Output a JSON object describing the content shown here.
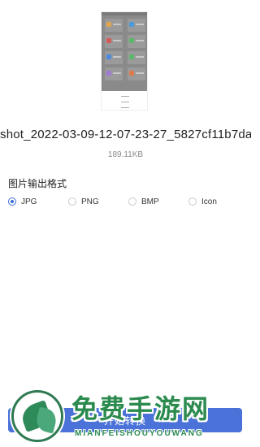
{
  "file": {
    "name": "shot_2022-03-09-12-07-23-27_5827cf11b7da",
    "size": "189.11KB"
  },
  "output_format": {
    "title": "图片输出格式",
    "selected": "JPG",
    "options": [
      "JPG",
      "PNG",
      "BMP",
      "Icon"
    ]
  },
  "convert_button": {
    "label": "开始转换"
  },
  "watermark": {
    "title": "免费手游网",
    "subtitle": "MIANFEISHOUYOUWANG"
  },
  "colors": {
    "accent": "#4a72d8",
    "watermark": "#2b8a4e"
  }
}
